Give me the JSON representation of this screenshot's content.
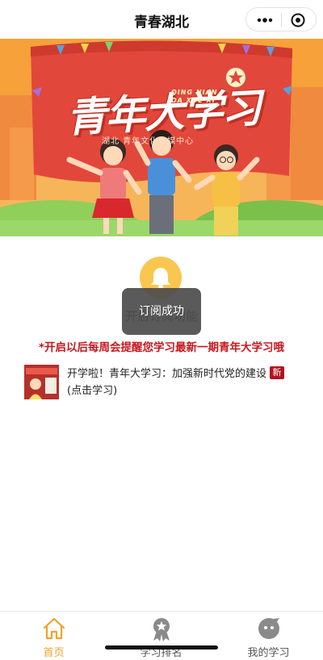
{
  "navbar": {
    "title": "青春湖北"
  },
  "banner": {
    "main_text": "青年大学习",
    "pinyin_line1": "QING NIAN",
    "pinyin_line2": "DA XUE XI",
    "subtitle": "湖北 青年文化传媒中心"
  },
  "subscribe": {
    "text": "开启订阅功能",
    "toast": "订阅成功",
    "hint": "*开启以后每周会提醒您学习最新一期青年大学习哦"
  },
  "article": {
    "title": "开学啦！青年大学习：加强新时代党的建设(点击学习)",
    "badge": "新"
  },
  "tabbar": {
    "tabs": [
      {
        "label": "首页",
        "active": true
      },
      {
        "label": "学习排名",
        "active": false
      },
      {
        "label": "我的学习",
        "active": false
      }
    ]
  },
  "colors": {
    "accent": "#f0a22c",
    "hint_red": "#c8161d",
    "banner_red": "#e2473b",
    "toast_bg": "#4c4c4c"
  }
}
